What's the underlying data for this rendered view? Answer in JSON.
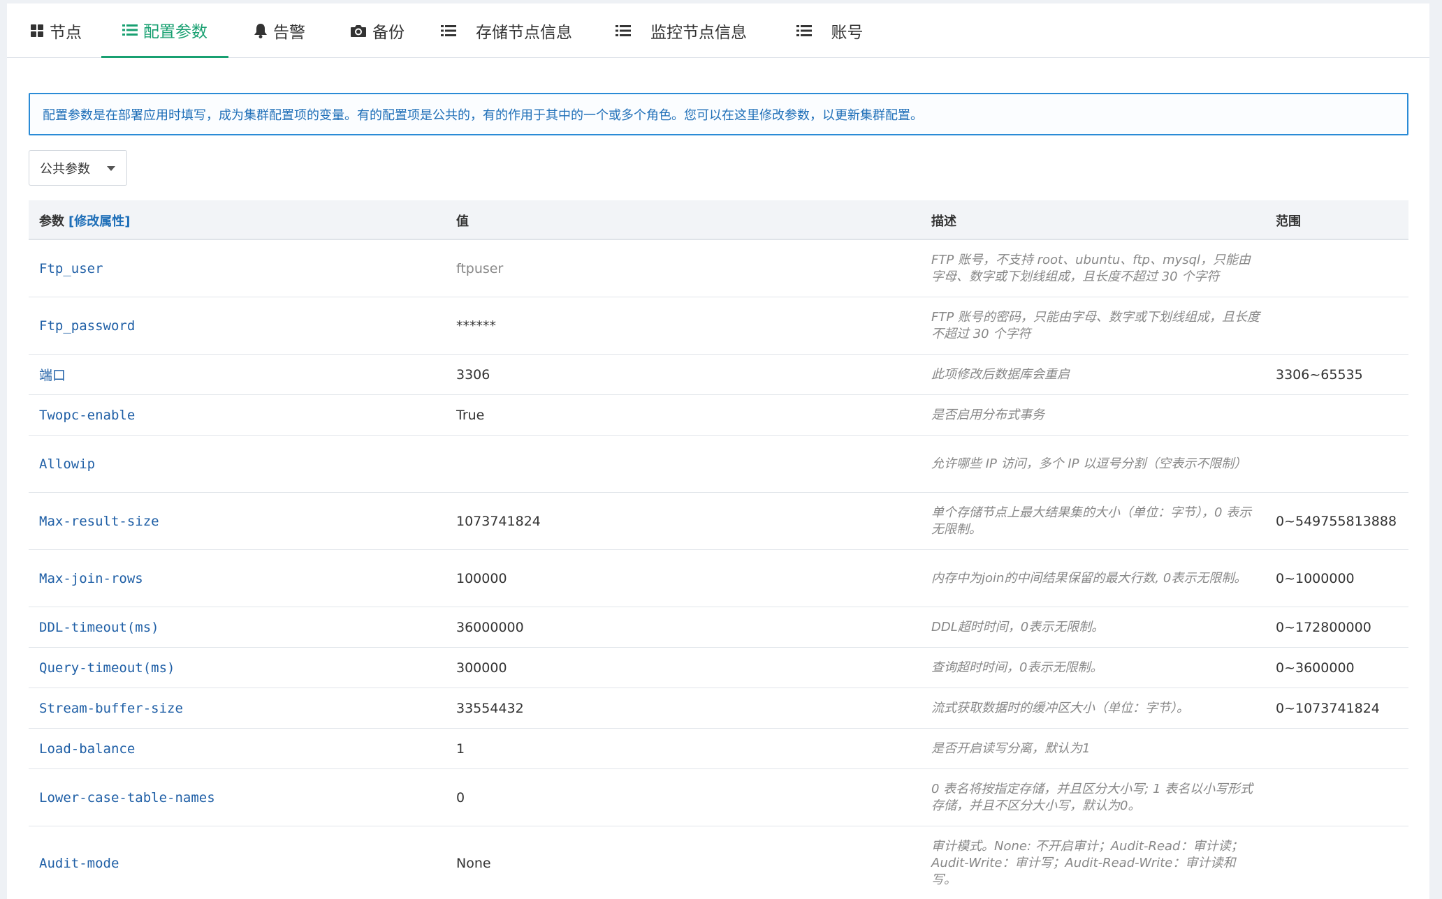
{
  "tabs": [
    {
      "label": "节点",
      "icon": "grid-icon"
    },
    {
      "label": "配置参数",
      "icon": "list-icon",
      "active": true
    },
    {
      "label": "告警",
      "icon": "bell-icon"
    },
    {
      "label": "备份",
      "icon": "camera-icon"
    },
    {
      "label": "存储节点信息",
      "icon": "list-icon"
    },
    {
      "label": "监控节点信息",
      "icon": "list-icon"
    },
    {
      "label": "账号",
      "icon": "list-icon"
    }
  ],
  "alert": {
    "text": "配置参数是在部署应用时填写，成为集群配置项的变量。有的配置项是公共的，有的作用于其中的一个或多个角色。您可以在这里修改参数，以更新集群配置。"
  },
  "dropdown": {
    "selected": "公共参数"
  },
  "table": {
    "headers": {
      "param": "参数",
      "edit": "[修改属性]",
      "value": "值",
      "desc": "描述",
      "range": "范围"
    },
    "rows": [
      {
        "param": "Ftp_user",
        "value": "ftpuser",
        "desc": "FTP 账号，不支持 root、ubuntu、ftp、mysql，只能由字母、数字或下划线组成，且长度不超过 30 个字符",
        "range": ""
      },
      {
        "param": "Ftp_password",
        "value": "******",
        "desc": "FTP 账号的密码，只能由字母、数字或下划线组成，且长度不超过 30 个字符",
        "range": ""
      },
      {
        "param": "端口",
        "value": "3306",
        "desc": "此项修改后数据库会重启",
        "range": "3306~65535"
      },
      {
        "param": "Twopc-enable",
        "value": "True",
        "desc": "是否启用分布式事务",
        "range": ""
      },
      {
        "param": "Allowip",
        "value": "",
        "desc": "允许哪些 IP 访问，多个 IP 以逗号分割（空表示不限制）",
        "range": ""
      },
      {
        "param": "Max-result-size",
        "value": "1073741824",
        "desc": "单个存储节点上最大结果集的大小（单位：字节），0 表示无限制。",
        "range": "0~549755813888"
      },
      {
        "param": "Max-join-rows",
        "value": "100000",
        "desc": "内存中为join的中间结果保留的最大行数, 0表示无限制。",
        "range": "0~1000000"
      },
      {
        "param": "DDL-timeout(ms)",
        "value": "36000000",
        "desc": "DDL超时时间，0表示无限制。",
        "range": "0~172800000"
      },
      {
        "param": "Query-timeout(ms)",
        "value": "300000",
        "desc": "查询超时时间，0表示无限制。",
        "range": "0~3600000"
      },
      {
        "param": "Stream-buffer-size",
        "value": "33554432",
        "desc": "流式获取数据时的缓冲区大小（单位：字节）。",
        "range": "0~1073741824"
      },
      {
        "param": "Load-balance",
        "value": "1",
        "desc": "是否开启读写分离，默认为1",
        "range": ""
      },
      {
        "param": "Lower-case-table-names",
        "value": "0",
        "desc": "0 表名将按指定存储，并且区分大小写; 1 表名以小写形式存储，并且不区分大小写，默认为0。",
        "range": ""
      },
      {
        "param": "Audit-mode",
        "value": "None",
        "desc": "审计模式。None: 不开启审计；Audit-Read：审计读；Audit-Write：审计写；Audit-Read-Write：审计读和写。",
        "range": ""
      }
    ]
  }
}
